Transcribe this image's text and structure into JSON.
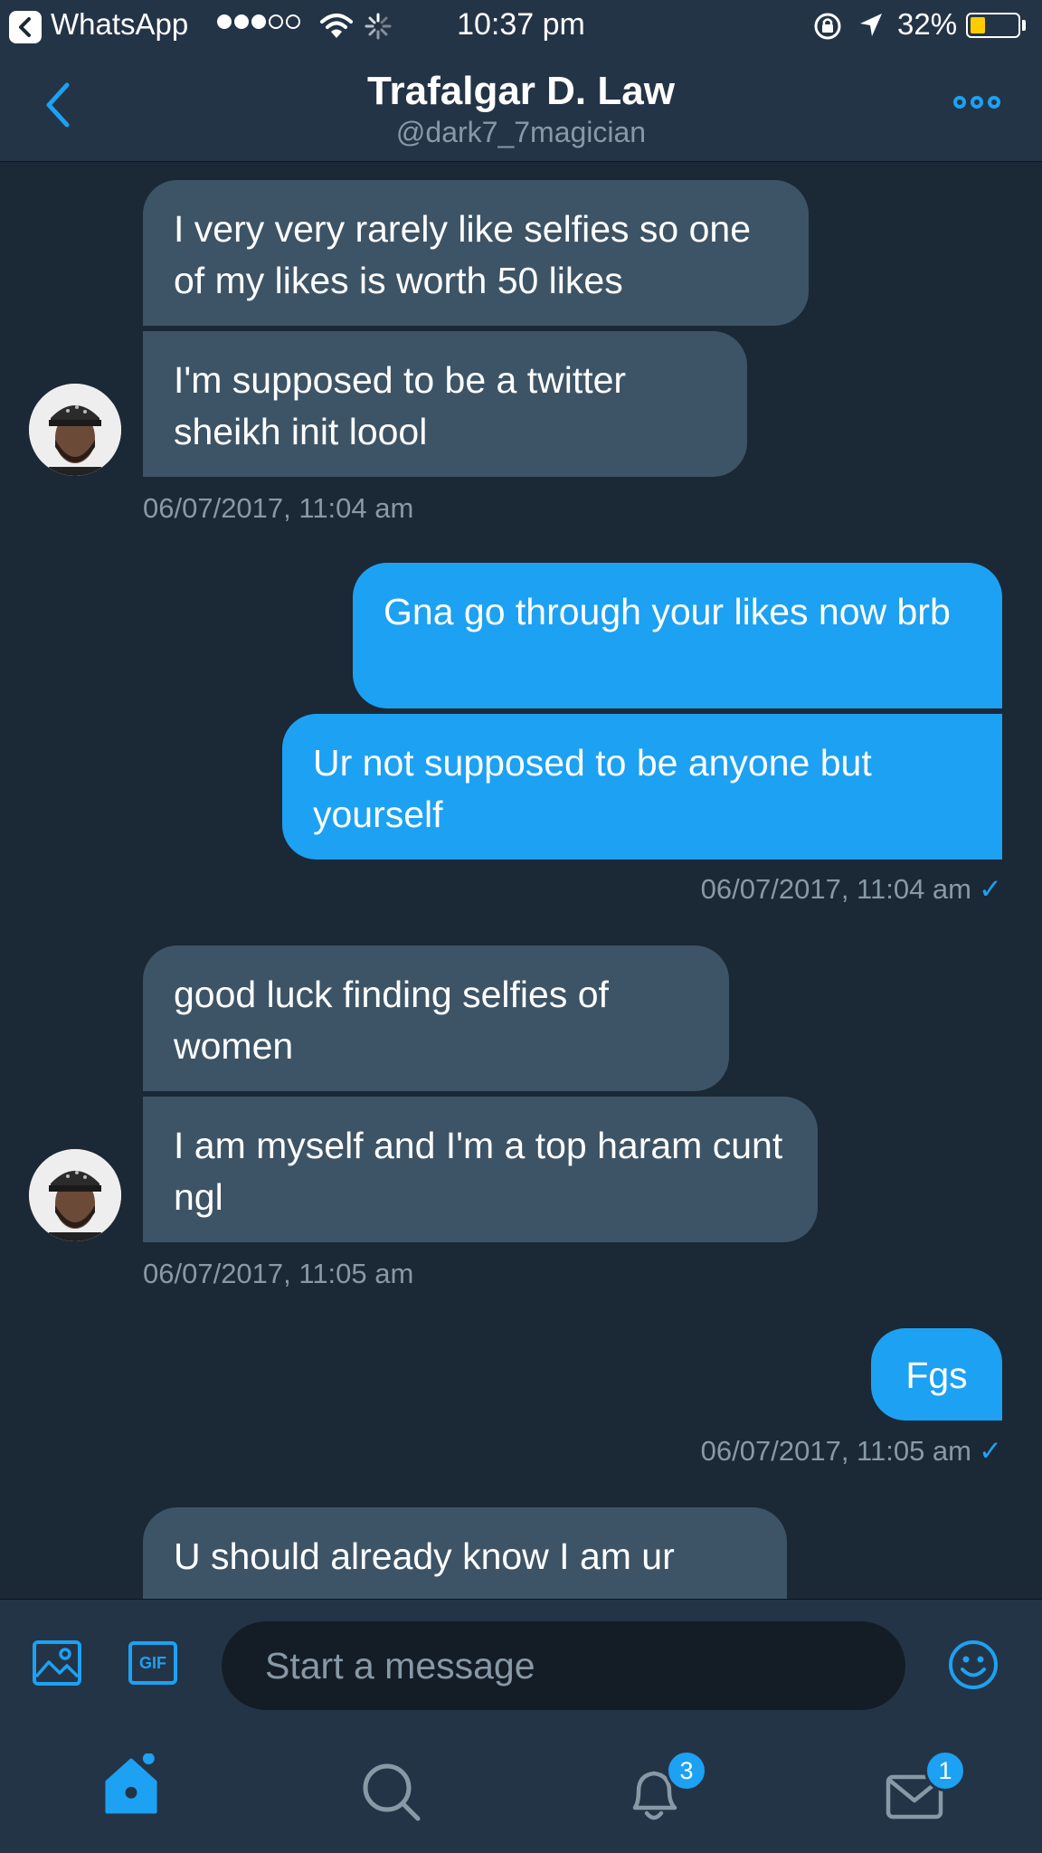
{
  "status_bar": {
    "back_app": "WhatsApp",
    "time": "10:37 pm",
    "battery_percent": "32%",
    "battery_level": 0.32,
    "signal_bars_filled": 3,
    "signal_bars_total": 5
  },
  "header": {
    "title": "Trafalgar D. Law",
    "handle": "@dark7_7magician",
    "back_icon": "chevron-left-icon",
    "more_icon": "more-options-icon"
  },
  "messages": [
    {
      "direction": "in",
      "text": "I very very rarely like selfies so one of my likes is worth 50 likes"
    },
    {
      "direction": "in",
      "text": "I'm supposed to be a twitter sheikh init loool"
    },
    {
      "timestamp": "06/07/2017, 11:04 am"
    },
    {
      "direction": "out",
      "text": "Gna go through your likes now brb"
    },
    {
      "direction": "out",
      "text": "Ur not supposed to be anyone but yourself"
    },
    {
      "timestamp": "06/07/2017, 11:04 am",
      "check": "✓"
    },
    {
      "direction": "in",
      "text": "good luck finding selfies of women"
    },
    {
      "direction": "in",
      "text": "I am myself and I'm a top haram cunt ngl"
    },
    {
      "timestamp": "06/07/2017, 11:05 am"
    },
    {
      "direction": "out",
      "text": "Fgs"
    },
    {
      "timestamp": "06/07/2017, 11:05 am",
      "check": "✓"
    },
    {
      "direction": "in",
      "text": "U should already know I am ur"
    }
  ],
  "composer": {
    "placeholder": "Start a message",
    "gif_label": "GIF",
    "media_icon": "image-icon",
    "emoji_icon": "emoji-icon"
  },
  "tabbar": {
    "home_icon": "home-icon",
    "search_icon": "search-icon",
    "notifications_icon": "bell-icon",
    "notifications_badge": "3",
    "messages_icon": "envelope-icon",
    "messages_badge": "1"
  },
  "colors": {
    "background": "#1b2836",
    "bar": "#243447",
    "incoming_bubble": "#3d5466",
    "outgoing_bubble": "#1da1f2",
    "secondary_text": "#8899a6",
    "battery": "#ffcc00"
  }
}
